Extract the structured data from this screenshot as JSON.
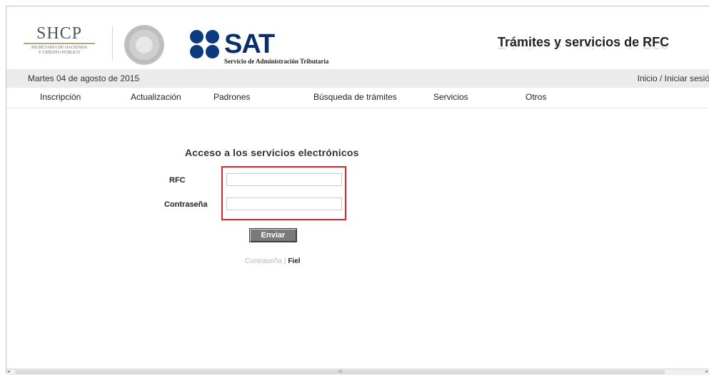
{
  "header": {
    "shcp_title": "SHCP",
    "shcp_subtitle_1": "SECRETARÍA DE HACIENDA",
    "shcp_subtitle_2": "Y CRÉDITO PÚBLICO",
    "sat_logo_text": "SAT",
    "sat_subtitle": "Servicio de Administración Tributaria",
    "page_title": "Trámites y servicios de RFC",
    "brand_color": "#0b3a7e"
  },
  "datebar": {
    "date": "Martes 04 de agosto de 2015",
    "login": "Inicio / Iniciar sesió"
  },
  "nav": {
    "items": [
      "Inscripción",
      "Actualización",
      "Padrones",
      "Búsqueda de trámites",
      "Servicios",
      "Otros"
    ]
  },
  "form": {
    "title": "Acceso a los servicios electrónicos",
    "rfc_label": "RFC",
    "rfc_value": "",
    "password_label": "Contraseña",
    "password_value": "",
    "submit_label": "Enviar",
    "link_password": "Contraseña",
    "link_separator": "|",
    "link_fiel": "Fiel",
    "highlight_color": "#d62828"
  },
  "scrollbar": {
    "grip": "III",
    "left_arrow": "◂",
    "right_arrow": "▸"
  }
}
